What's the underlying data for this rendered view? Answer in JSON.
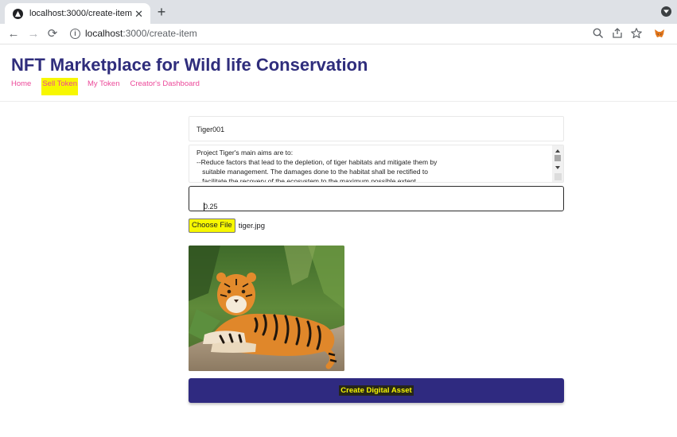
{
  "browser": {
    "tab_title": "localhost:3000/create-item",
    "tab_close": "✕",
    "new_tab": "+",
    "url_host": "localhost",
    "url_path": ":3000/create-item"
  },
  "header": {
    "title": "NFT Marketplace for Wild life Conservation",
    "nav": [
      {
        "label": "Home",
        "highlighted": false
      },
      {
        "label": "Sell Token",
        "highlighted": true
      },
      {
        "label": "My Token",
        "highlighted": false
      },
      {
        "label": "Creator's Dashboard",
        "highlighted": false
      }
    ]
  },
  "form": {
    "name_value": "Tiger001",
    "description_value": "Project Tiger's main aims are to:\n--Reduce factors that lead to the depletion, of tiger habitats and mitigate them by\n   suitable management. The damages done to the habitat shall be rectified to\n   facilitate the recovery of the ecosystem to the maximum possible extent.",
    "price_value": "0.25",
    "choose_file_label": "Choose File",
    "file_name": "tiger.jpg",
    "submit_label": "Create Digital Asset"
  },
  "colors": {
    "title": "#2f2d7c",
    "nav_link": "#ec4899",
    "highlight": "#f7f701",
    "button_bg": "#2f2a80"
  },
  "icons": [
    "site-favicon",
    "close-icon",
    "new-tab-icon",
    "tab-menu-icon",
    "back-icon",
    "forward-icon",
    "reload-icon",
    "info-icon",
    "zoom-icon",
    "share-icon",
    "star-icon",
    "metamask-icon"
  ]
}
